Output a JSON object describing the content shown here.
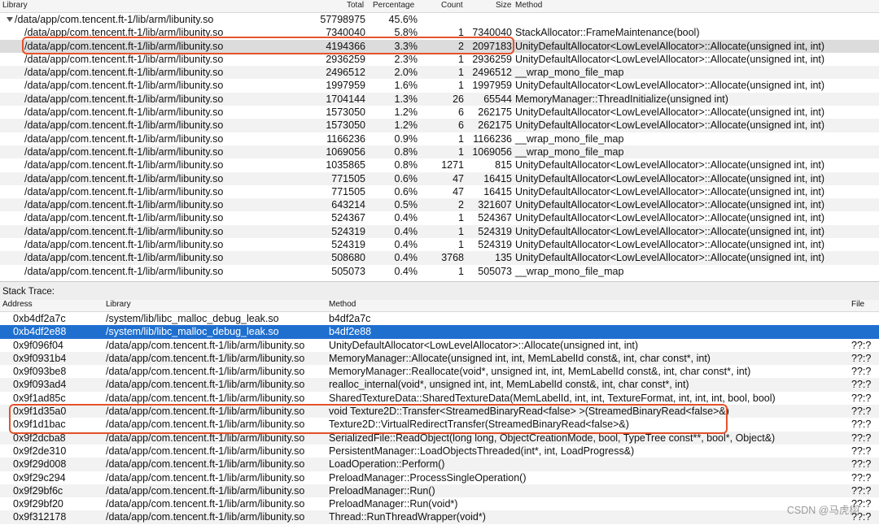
{
  "top_table": {
    "columns": {
      "library": "Library",
      "total": "Total",
      "percentage": "Percentage",
      "count": "Count",
      "size": "Size",
      "method": "Method"
    },
    "parent": {
      "library": "/data/app/com.tencent.ft-1/lib/arm/libunity.so",
      "total": "57798975",
      "percentage": "45.6%"
    },
    "rows": [
      {
        "library": "/data/app/com.tencent.ft-1/lib/arm/libunity.so",
        "total": "7340040",
        "percentage": "5.8%",
        "count": "1",
        "size": "7340040",
        "method": "StackAllocator::FrameMaintenance(bool)"
      },
      {
        "library": "/data/app/com.tencent.ft-1/lib/arm/libunity.so",
        "total": "4194366",
        "percentage": "3.3%",
        "count": "2",
        "size": "2097183",
        "method": "UnityDefaultAllocator<LowLevelAllocator>::Allocate(unsigned int, int)"
      },
      {
        "library": "/data/app/com.tencent.ft-1/lib/arm/libunity.so",
        "total": "2936259",
        "percentage": "2.3%",
        "count": "1",
        "size": "2936259",
        "method": "UnityDefaultAllocator<LowLevelAllocator>::Allocate(unsigned int, int)"
      },
      {
        "library": "/data/app/com.tencent.ft-1/lib/arm/libunity.so",
        "total": "2496512",
        "percentage": "2.0%",
        "count": "1",
        "size": "2496512",
        "method": "__wrap_mono_file_map"
      },
      {
        "library": "/data/app/com.tencent.ft-1/lib/arm/libunity.so",
        "total": "1997959",
        "percentage": "1.6%",
        "count": "1",
        "size": "1997959",
        "method": "UnityDefaultAllocator<LowLevelAllocator>::Allocate(unsigned int, int)"
      },
      {
        "library": "/data/app/com.tencent.ft-1/lib/arm/libunity.so",
        "total": "1704144",
        "percentage": "1.3%",
        "count": "26",
        "size": "65544",
        "method": "MemoryManager::ThreadInitialize(unsigned int)"
      },
      {
        "library": "/data/app/com.tencent.ft-1/lib/arm/libunity.so",
        "total": "1573050",
        "percentage": "1.2%",
        "count": "6",
        "size": "262175",
        "method": "UnityDefaultAllocator<LowLevelAllocator>::Allocate(unsigned int, int)"
      },
      {
        "library": "/data/app/com.tencent.ft-1/lib/arm/libunity.so",
        "total": "1573050",
        "percentage": "1.2%",
        "count": "6",
        "size": "262175",
        "method": "UnityDefaultAllocator<LowLevelAllocator>::Allocate(unsigned int, int)"
      },
      {
        "library": "/data/app/com.tencent.ft-1/lib/arm/libunity.so",
        "total": "1166236",
        "percentage": "0.9%",
        "count": "1",
        "size": "1166236",
        "method": "__wrap_mono_file_map"
      },
      {
        "library": "/data/app/com.tencent.ft-1/lib/arm/libunity.so",
        "total": "1069056",
        "percentage": "0.8%",
        "count": "1",
        "size": "1069056",
        "method": "__wrap_mono_file_map"
      },
      {
        "library": "/data/app/com.tencent.ft-1/lib/arm/libunity.so",
        "total": "1035865",
        "percentage": "0.8%",
        "count": "1271",
        "size": "815",
        "method": "UnityDefaultAllocator<LowLevelAllocator>::Allocate(unsigned int, int)"
      },
      {
        "library": "/data/app/com.tencent.ft-1/lib/arm/libunity.so",
        "total": "771505",
        "percentage": "0.6%",
        "count": "47",
        "size": "16415",
        "method": "UnityDefaultAllocator<LowLevelAllocator>::Allocate(unsigned int, int)"
      },
      {
        "library": "/data/app/com.tencent.ft-1/lib/arm/libunity.so",
        "total": "771505",
        "percentage": "0.6%",
        "count": "47",
        "size": "16415",
        "method": "UnityDefaultAllocator<LowLevelAllocator>::Allocate(unsigned int, int)"
      },
      {
        "library": "/data/app/com.tencent.ft-1/lib/arm/libunity.so",
        "total": "643214",
        "percentage": "0.5%",
        "count": "2",
        "size": "321607",
        "method": "UnityDefaultAllocator<LowLevelAllocator>::Allocate(unsigned int, int)"
      },
      {
        "library": "/data/app/com.tencent.ft-1/lib/arm/libunity.so",
        "total": "524367",
        "percentage": "0.4%",
        "count": "1",
        "size": "524367",
        "method": "UnityDefaultAllocator<LowLevelAllocator>::Allocate(unsigned int, int)"
      },
      {
        "library": "/data/app/com.tencent.ft-1/lib/arm/libunity.so",
        "total": "524319",
        "percentage": "0.4%",
        "count": "1",
        "size": "524319",
        "method": "UnityDefaultAllocator<LowLevelAllocator>::Allocate(unsigned int, int)"
      },
      {
        "library": "/data/app/com.tencent.ft-1/lib/arm/libunity.so",
        "total": "524319",
        "percentage": "0.4%",
        "count": "1",
        "size": "524319",
        "method": "UnityDefaultAllocator<LowLevelAllocator>::Allocate(unsigned int, int)"
      },
      {
        "library": "/data/app/com.tencent.ft-1/lib/arm/libunity.so",
        "total": "508680",
        "percentage": "0.4%",
        "count": "3768",
        "size": "135",
        "method": "UnityDefaultAllocator<LowLevelAllocator>::Allocate(unsigned int, int)"
      },
      {
        "library": "/data/app/com.tencent.ft-1/lib/arm/libunity.so",
        "total": "505073",
        "percentage": "0.4%",
        "count": "1",
        "size": "505073",
        "method": "__wrap_mono_file_map"
      }
    ],
    "selected_row_index": 1
  },
  "stack_trace": {
    "title": "Stack Trace:",
    "columns": {
      "address": "Address",
      "library": "Library",
      "method": "Method",
      "file": "File"
    },
    "rows": [
      {
        "address": "0xb4df2a7c",
        "library": "/system/lib/libc_malloc_debug_leak.so",
        "method": "b4df2a7c",
        "file": ""
      },
      {
        "address": "0xb4df2e88",
        "library": "/system/lib/libc_malloc_debug_leak.so",
        "method": "b4df2e88",
        "file": ""
      },
      {
        "address": "0x9f096f04",
        "library": "/data/app/com.tencent.ft-1/lib/arm/libunity.so",
        "method": "UnityDefaultAllocator<LowLevelAllocator>::Allocate(unsigned int, int)",
        "file": "??:?"
      },
      {
        "address": "0x9f0931b4",
        "library": "/data/app/com.tencent.ft-1/lib/arm/libunity.so",
        "method": "MemoryManager::Allocate(unsigned int, int, MemLabelId const&, int, char const*, int)",
        "file": "??:?"
      },
      {
        "address": "0x9f093be8",
        "library": "/data/app/com.tencent.ft-1/lib/arm/libunity.so",
        "method": "MemoryManager::Reallocate(void*, unsigned int, int, MemLabelId const&, int, char const*, int)",
        "file": "??:?"
      },
      {
        "address": "0x9f093ad4",
        "library": "/data/app/com.tencent.ft-1/lib/arm/libunity.so",
        "method": "realloc_internal(void*, unsigned int, int, MemLabelId const&, int, char const*, int)",
        "file": "??:?"
      },
      {
        "address": "0x9f1ad85c",
        "library": "/data/app/com.tencent.ft-1/lib/arm/libunity.so",
        "method": "SharedTextureData::SharedTextureData(MemLabelId, int, int, TextureFormat, int, int, int, bool, bool)",
        "file": "??:?"
      },
      {
        "address": "0x9f1d35a0",
        "library": "/data/app/com.tencent.ft-1/lib/arm/libunity.so",
        "method": "void Texture2D::Transfer<StreamedBinaryRead<false> >(StreamedBinaryRead<false>&)",
        "file": "??:?"
      },
      {
        "address": "0x9f1d1bac",
        "library": "/data/app/com.tencent.ft-1/lib/arm/libunity.so",
        "method": "Texture2D::VirtualRedirectTransfer(StreamedBinaryRead<false>&)",
        "file": "??:?"
      },
      {
        "address": "0x9f2dcba8",
        "library": "/data/app/com.tencent.ft-1/lib/arm/libunity.so",
        "method": "SerializedFile::ReadObject(long long, ObjectCreationMode, bool, TypeTree const**, bool*, Object&)",
        "file": "??:?"
      },
      {
        "address": "0x9f2de310",
        "library": "/data/app/com.tencent.ft-1/lib/arm/libunity.so",
        "method": "PersistentManager::LoadObjectsThreaded(int*, int, LoadProgress&)",
        "file": "??:?"
      },
      {
        "address": "0x9f29d008",
        "library": "/data/app/com.tencent.ft-1/lib/arm/libunity.so",
        "method": "LoadOperation::Perform()",
        "file": "??:?"
      },
      {
        "address": "0x9f29c294",
        "library": "/data/app/com.tencent.ft-1/lib/arm/libunity.so",
        "method": "PreloadManager::ProcessSingleOperation()",
        "file": "??:?"
      },
      {
        "address": "0x9f29bf6c",
        "library": "/data/app/com.tencent.ft-1/lib/arm/libunity.so",
        "method": "PreloadManager::Run()",
        "file": "??:?"
      },
      {
        "address": "0x9f29bf20",
        "library": "/data/app/com.tencent.ft-1/lib/arm/libunity.so",
        "method": "PreloadManager::Run(void*)",
        "file": "??:?"
      },
      {
        "address": "0x9f312178",
        "library": "/data/app/com.tencent.ft-1/lib/arm/libunity.so",
        "method": "Thread::RunThreadWrapper(void*)",
        "file": "??:?"
      }
    ],
    "selected_row_index": 1
  },
  "watermark": "CSDN @马虎栩",
  "colors": {
    "selection_blue": "#1f6fcf",
    "highlight_orange": "#e5532a",
    "row_alt": "#f2f2f2"
  }
}
